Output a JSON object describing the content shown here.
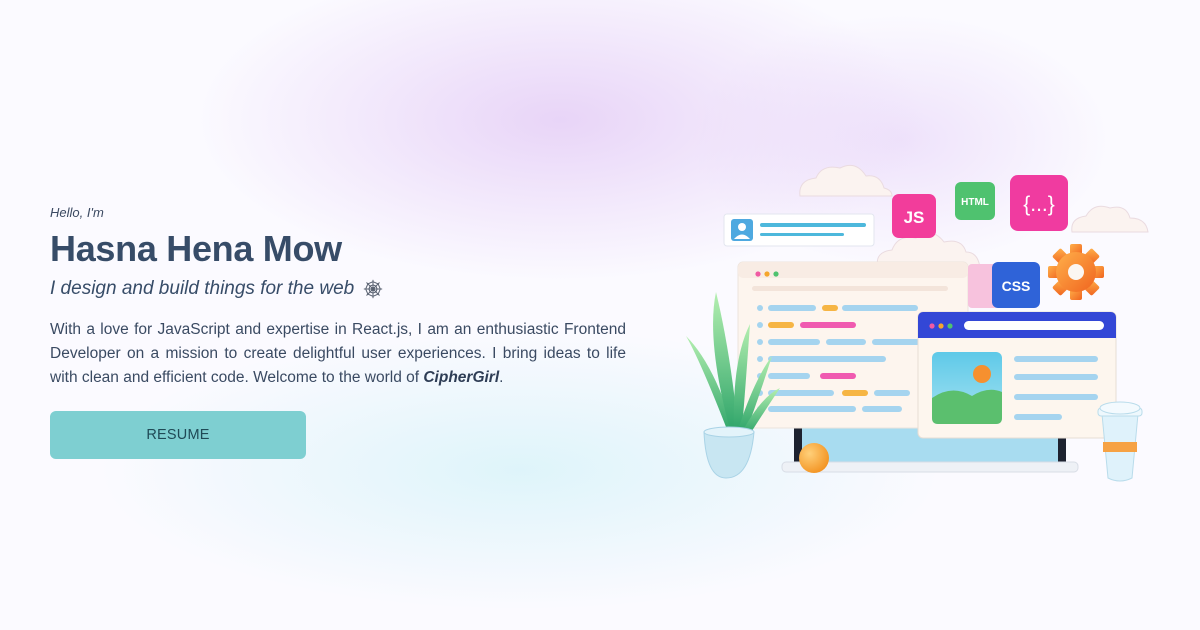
{
  "hero": {
    "greeting": "Hello, I'm",
    "name": "Hasna Hena Mow",
    "tagline": "I design and build things for the web",
    "bio_text": "With a love for JavaScript and expertise in React.js, I am an enthusiastic Frontend Developer on a mission to create delightful user experiences. I bring ideas to life with clean and efficient code. Welcome to the world of ",
    "bio_brand": "CipherGirl",
    "bio_end": ".",
    "resume_label": "RESUME"
  },
  "illustration": {
    "badges": {
      "js": "JS",
      "html": "HTML",
      "json": "{...}",
      "css": "CSS"
    }
  },
  "colors": {
    "text": "#374c68",
    "button": "#7ecfd1",
    "button_text": "#1f4a56",
    "js_badge": "#f23d9b",
    "html_badge": "#4fc26f",
    "json_badge": "#f03ba0",
    "css_badge": "#2f63d8",
    "browser_bar": "#3347d6",
    "gear": "#f6842c"
  }
}
